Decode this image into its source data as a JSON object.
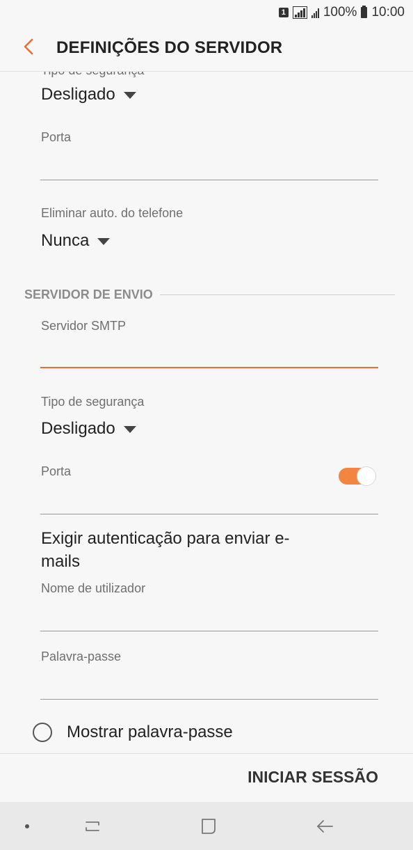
{
  "status_bar": {
    "sim_label": "1",
    "battery": "100%",
    "time": "10:00"
  },
  "header": {
    "title": "DEFINIÇÕES DO SERVIDOR"
  },
  "incoming": {
    "security_label": "Tipo de segurança",
    "security_value": "Desligado",
    "port_label": "Porta",
    "port_value": "",
    "auto_delete_label": "Eliminar auto. do telefone",
    "auto_delete_value": "Nunca"
  },
  "outgoing": {
    "section_title": "SERVIDOR DE ENVIO",
    "smtp_label": "Servidor SMTP",
    "smtp_value": "",
    "security_label": "Tipo de segurança",
    "security_value": "Desligado",
    "port_label": "Porta",
    "port_value": "",
    "auth_toggle_label": "Exigir autenticação para enviar e-mails",
    "auth_toggle_on": true,
    "username_label": "Nome de utilizador",
    "username_value": "",
    "password_label": "Palavra-passe",
    "password_value": "",
    "show_password_label": "Mostrar palavra-passe"
  },
  "footer": {
    "login_label": "INICIAR SESSÃO"
  },
  "icons": {
    "back": "chevron-left-icon",
    "nav_recent": "recent-apps-icon",
    "nav_home": "home-icon",
    "nav_back": "back-arrow-icon"
  },
  "colors": {
    "accent": "#f06a36",
    "toggle_on": "#f2853f",
    "background": "#f7f7f7",
    "nav_background": "#e9e9e9"
  }
}
